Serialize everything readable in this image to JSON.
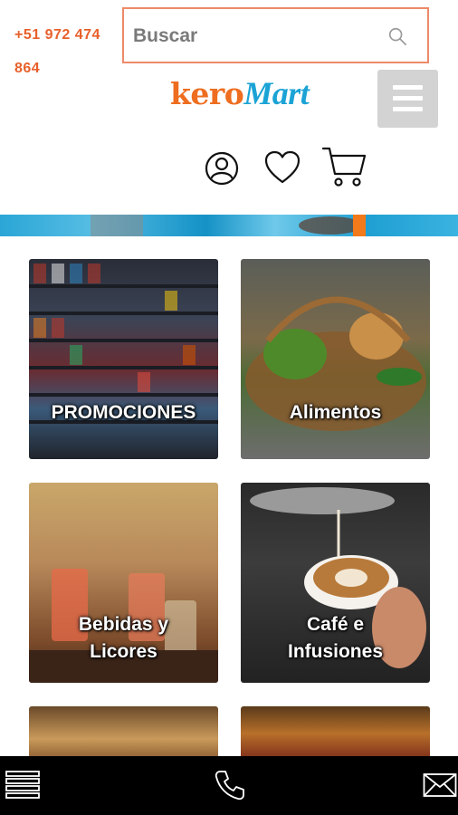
{
  "header": {
    "phone": "+51 972 474 864",
    "search_placeholder": "Buscar",
    "search_icon": "search-icon",
    "logo_part1": "kero",
    "logo_part2": "Mart",
    "menu_icon": "hamburger-icon"
  },
  "actions": {
    "account_icon": "user-icon",
    "wishlist_icon": "heart-icon",
    "cart_icon": "cart-icon"
  },
  "categories": [
    {
      "line1": "PROMOCIONES",
      "line2": ""
    },
    {
      "line1": "Alimentos",
      "line2": ""
    },
    {
      "line1": "Bebidas y",
      "line2": "Licores"
    },
    {
      "line1": "Café e",
      "line2": "Infusiones"
    }
  ],
  "bottom_bar": {
    "menu_icon": "list-menu-icon",
    "phone_icon": "phone-icon",
    "mail_icon": "mail-icon"
  },
  "colors": {
    "accent_orange": "#e8602b",
    "brand_blue": "#1ba3d5",
    "search_border": "#ec8a69",
    "bottom_bar": "#000000"
  }
}
